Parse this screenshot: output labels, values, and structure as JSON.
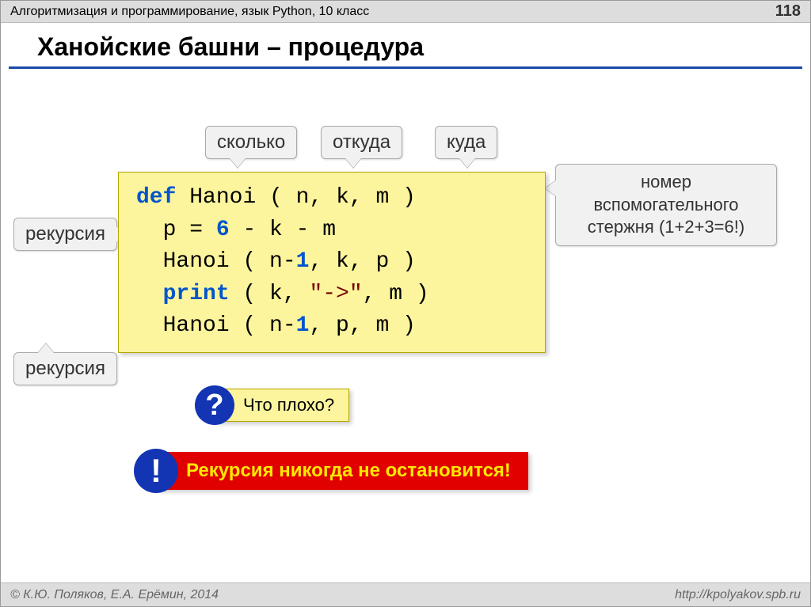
{
  "header": {
    "title": "Алгоритмизация и программирование, язык Python, 10 класс",
    "page": "118"
  },
  "title": "Ханойские башни – процедура",
  "callouts": {
    "howMany": "сколько",
    "from": "откуда",
    "to": "куда",
    "aux1": "номер",
    "aux2": "вспомогательного",
    "aux3": "стержня (1+2+3=6!)",
    "rec1": "рекурсия",
    "rec2": "рекурсия"
  },
  "code": {
    "def": "def",
    "funcDecl": "Hanoi ( n, k, m )",
    "pLine_pre": "p = ",
    "pLine_num": "6",
    "pLine_post": " - k - m",
    "call1_pre": "Hanoi ( n-",
    "call1_num": "1",
    "call1_post": ", k, p )",
    "print": "print",
    "printArgs_pre": " ( k, ",
    "printArgs_str": "\"->\"",
    "printArgs_post": ", m )",
    "call2_pre": "Hanoi ( n-",
    "call2_num": "1",
    "call2_post": ", p, m )"
  },
  "question": {
    "mark": "?",
    "text": "Что плохо?"
  },
  "warning": {
    "mark": "!",
    "text": "Рекурсия никогда не остановится!"
  },
  "footer": {
    "copyright": "© К.Ю. Поляков, Е.А. Ерёмин, 2014",
    "url": "http://kpolyakov.spb.ru"
  }
}
